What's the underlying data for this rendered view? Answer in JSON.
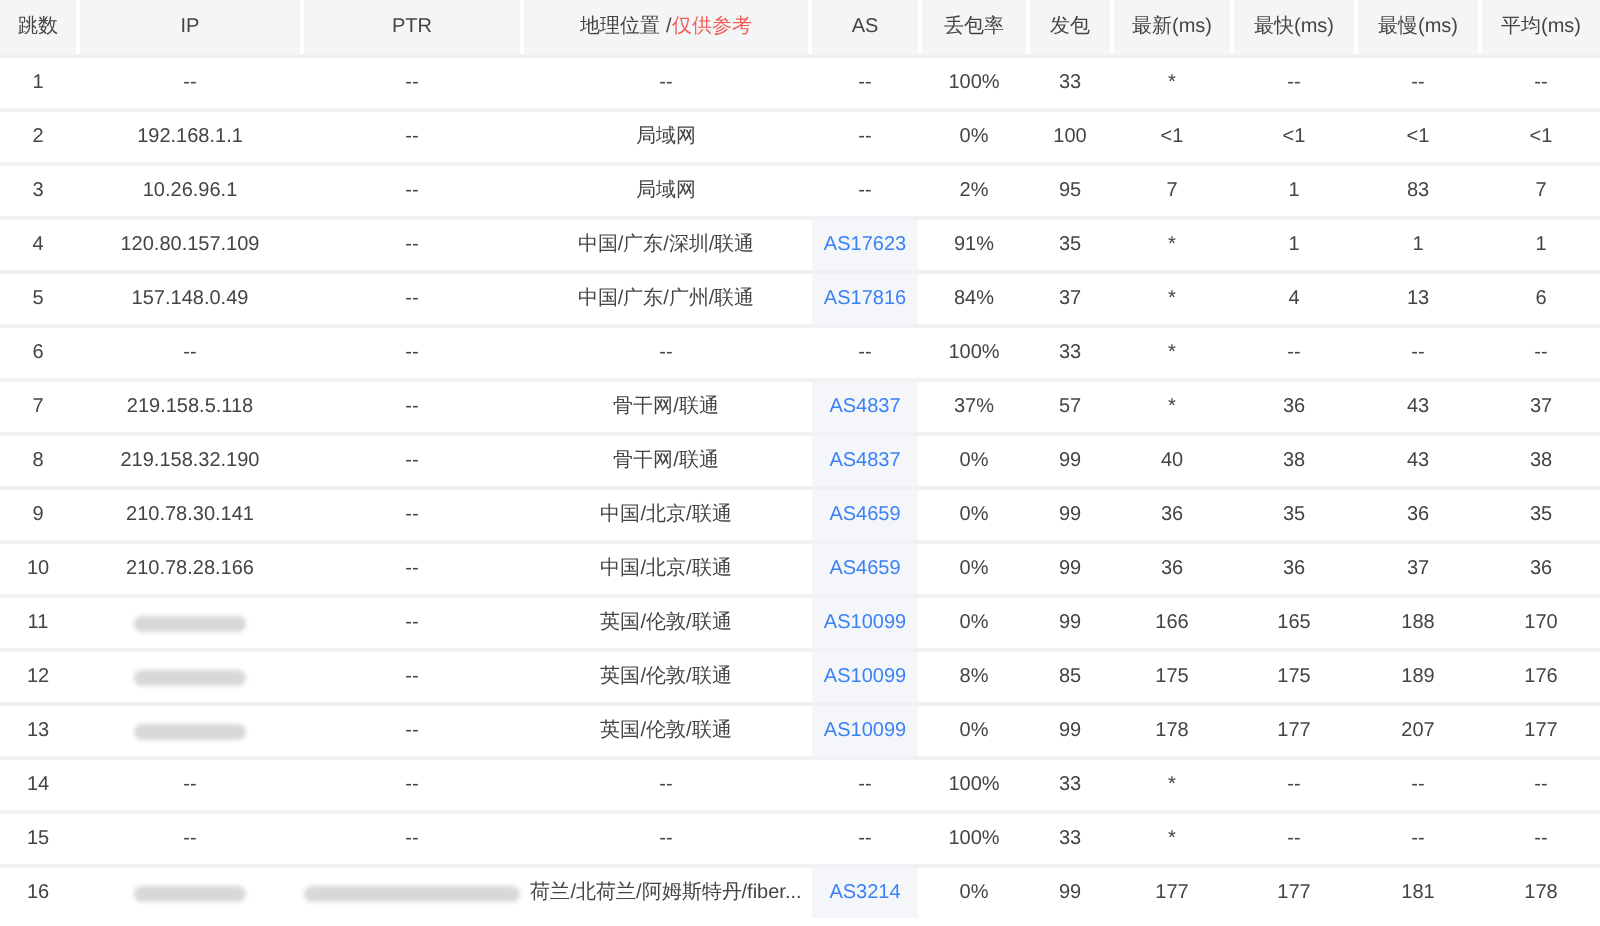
{
  "table": {
    "columns": [
      {
        "label": "跳数"
      },
      {
        "label": "IP"
      },
      {
        "label": "PTR"
      },
      {
        "label": "地理位置 /",
        "note": "仅供参考"
      },
      {
        "label": "AS"
      },
      {
        "label": "丢包率"
      },
      {
        "label": "发包"
      },
      {
        "label": "最新(ms)"
      },
      {
        "label": "最快(ms)"
      },
      {
        "label": "最慢(ms)"
      },
      {
        "label": "平均(ms)"
      }
    ],
    "rows": [
      {
        "hop": "1",
        "ip": "--",
        "ip_redacted": false,
        "ptr": "--",
        "ptr_redacted": false,
        "location": "--",
        "as": "--",
        "as_link": false,
        "loss": "100%",
        "sent": "33",
        "last": "*",
        "best": "--",
        "worst": "--",
        "avg": "--"
      },
      {
        "hop": "2",
        "ip": "192.168.1.1",
        "ip_redacted": false,
        "ptr": "--",
        "ptr_redacted": false,
        "location": "局域网",
        "as": "--",
        "as_link": false,
        "loss": "0%",
        "sent": "100",
        "last": "<1",
        "best": "<1",
        "worst": "<1",
        "avg": "<1"
      },
      {
        "hop": "3",
        "ip": "10.26.96.1",
        "ip_redacted": false,
        "ptr": "--",
        "ptr_redacted": false,
        "location": "局域网",
        "as": "--",
        "as_link": false,
        "loss": "2%",
        "sent": "95",
        "last": "7",
        "best": "1",
        "worst": "83",
        "avg": "7"
      },
      {
        "hop": "4",
        "ip": "120.80.157.109",
        "ip_redacted": false,
        "ptr": "--",
        "ptr_redacted": false,
        "location": "中国/广东/深圳/联通",
        "as": "AS17623",
        "as_link": true,
        "loss": "91%",
        "sent": "35",
        "last": "*",
        "best": "1",
        "worst": "1",
        "avg": "1"
      },
      {
        "hop": "5",
        "ip": "157.148.0.49",
        "ip_redacted": false,
        "ptr": "--",
        "ptr_redacted": false,
        "location": "中国/广东/广州/联通",
        "as": "AS17816",
        "as_link": true,
        "loss": "84%",
        "sent": "37",
        "last": "*",
        "best": "4",
        "worst": "13",
        "avg": "6"
      },
      {
        "hop": "6",
        "ip": "--",
        "ip_redacted": false,
        "ptr": "--",
        "ptr_redacted": false,
        "location": "--",
        "as": "--",
        "as_link": false,
        "loss": "100%",
        "sent": "33",
        "last": "*",
        "best": "--",
        "worst": "--",
        "avg": "--"
      },
      {
        "hop": "7",
        "ip": "219.158.5.118",
        "ip_redacted": false,
        "ptr": "--",
        "ptr_redacted": false,
        "location": "骨干网/联通",
        "as": "AS4837",
        "as_link": true,
        "loss": "37%",
        "sent": "57",
        "last": "*",
        "best": "36",
        "worst": "43",
        "avg": "37"
      },
      {
        "hop": "8",
        "ip": "219.158.32.190",
        "ip_redacted": false,
        "ptr": "--",
        "ptr_redacted": false,
        "location": "骨干网/联通",
        "as": "AS4837",
        "as_link": true,
        "loss": "0%",
        "sent": "99",
        "last": "40",
        "best": "38",
        "worst": "43",
        "avg": "38"
      },
      {
        "hop": "9",
        "ip": "210.78.30.141",
        "ip_redacted": false,
        "ptr": "--",
        "ptr_redacted": false,
        "location": "中国/北京/联通",
        "as": "AS4659",
        "as_link": true,
        "loss": "0%",
        "sent": "99",
        "last": "36",
        "best": "35",
        "worst": "36",
        "avg": "35"
      },
      {
        "hop": "10",
        "ip": "210.78.28.166",
        "ip_redacted": false,
        "ptr": "--",
        "ptr_redacted": false,
        "location": "中国/北京/联通",
        "as": "AS4659",
        "as_link": true,
        "loss": "0%",
        "sent": "99",
        "last": "36",
        "best": "36",
        "worst": "37",
        "avg": "36"
      },
      {
        "hop": "11",
        "ip_redacted": true,
        "ptr": "--",
        "ptr_redacted": false,
        "location": "英国/伦敦/联通",
        "as": "AS10099",
        "as_link": true,
        "loss": "0%",
        "sent": "99",
        "last": "166",
        "best": "165",
        "worst": "188",
        "avg": "170"
      },
      {
        "hop": "12",
        "ip_redacted": true,
        "ptr": "--",
        "ptr_redacted": false,
        "location": "英国/伦敦/联通",
        "as": "AS10099",
        "as_link": true,
        "loss": "8%",
        "sent": "85",
        "last": "175",
        "best": "175",
        "worst": "189",
        "avg": "176"
      },
      {
        "hop": "13",
        "ip_redacted": true,
        "ptr": "--",
        "ptr_redacted": false,
        "location": "英国/伦敦/联通",
        "as": "AS10099",
        "as_link": true,
        "loss": "0%",
        "sent": "99",
        "last": "178",
        "best": "177",
        "worst": "207",
        "avg": "177"
      },
      {
        "hop": "14",
        "ip": "--",
        "ip_redacted": false,
        "ptr": "--",
        "ptr_redacted": false,
        "location": "--",
        "as": "--",
        "as_link": false,
        "loss": "100%",
        "sent": "33",
        "last": "*",
        "best": "--",
        "worst": "--",
        "avg": "--"
      },
      {
        "hop": "15",
        "ip": "--",
        "ip_redacted": false,
        "ptr": "--",
        "ptr_redacted": false,
        "location": "--",
        "as": "--",
        "as_link": false,
        "loss": "100%",
        "sent": "33",
        "last": "*",
        "best": "--",
        "worst": "--",
        "avg": "--"
      },
      {
        "hop": "16",
        "ip_redacted": true,
        "ptr_redacted": true,
        "location": "荷兰/北荷兰/阿姆斯特丹/fiber...",
        "as": "AS3214",
        "as_link": true,
        "loss": "0%",
        "sent": "99",
        "last": "177",
        "best": "177",
        "worst": "181",
        "avg": "178"
      }
    ]
  }
}
